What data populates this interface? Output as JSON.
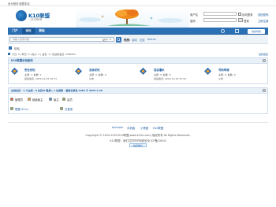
{
  "topbar": {
    "set_home": "设为首页",
    "bookmark": "收藏本站"
  },
  "header": {
    "logo_title": "K10联盟",
    "logo_sub": "110046",
    "login": {
      "username_label": "用户名",
      "username_value": "",
      "password_label": "密码",
      "auto_login": "自动登录",
      "find_password": "找回密码",
      "login_button": "登录",
      "register": "立即注册"
    }
  },
  "nav": {
    "tabs": [
      "门户",
      "论坛",
      "群组"
    ],
    "right_button": "快捷导航"
  },
  "search": {
    "placeholder": "请输入搜索内容",
    "scope": "帖子",
    "hot_label": "热搜:",
    "hot_items": [
      "活动",
      "交友",
      "discuz"
    ]
  },
  "breadcrumb": {
    "home": "论坛",
    "stats": "今日: 0 | 昨日: 0 | 帖子: 1 | 会员: 1 | 欢迎新会员: 3d8b5fd",
    "view_new": "最新回复"
  },
  "forum_section": {
    "title": "K10联盟论坛板块",
    "forums": [
      {
        "name": "安全论坛",
        "stats": "主题: 1, 帖数: 1",
        "last": "最后发表: 2024-12-25 16:11"
      },
      {
        "name": "业余论坛",
        "stats": "主题: 0, 帖数: 0",
        "last": "从未"
      },
      {
        "name": "自由灌水",
        "stats": "主题: 0, 帖数: 0",
        "last": "最后发表: 2024-12-25 22:44"
      },
      {
        "name": "号码申请",
        "stats": "主题: 0, 帖数: 0",
        "last": "从未"
      }
    ]
  },
  "online_section": {
    "title": "在线会员 - 1 人在线 - 0 会员(0 隐身), 1 位游客 - 最高记录是 1086 于 2025-4-26",
    "groups": [
      "管理员",
      "超级版主",
      "版主",
      "会员"
    ],
    "members": [
      "联盟-23.cc",
      "已登录"
    ]
  },
  "footer": {
    "links": [
      "Archiver",
      "手机版",
      "小黑屋",
      "K10联盟"
    ],
    "copyright": "Copyright © 2024-2024 K10联盟(www.k10u.com) 版权所有 All Rights Reserved.",
    "powered": "K10联盟 - 我们共同守护网络安全 ICP备15005",
    "badge": "站点统计"
  },
  "colors": {
    "brand": "#2b6fb4",
    "link": "#1a5aa0"
  }
}
